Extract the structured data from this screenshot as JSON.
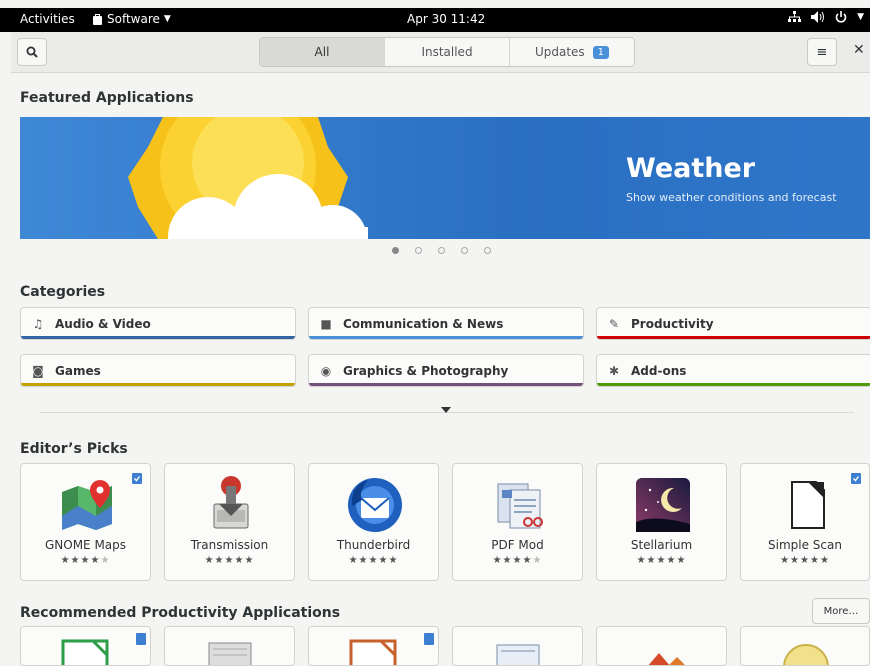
{
  "topbar": {
    "activities": "Activities",
    "app_menu": "Software",
    "clock": "Apr 30  11:42"
  },
  "header": {
    "tabs": [
      {
        "label": "All",
        "active": true
      },
      {
        "label": "Installed",
        "active": false
      },
      {
        "label": "Updates",
        "active": false,
        "badge": "1"
      }
    ]
  },
  "featured": {
    "heading": "Featured Applications",
    "banner_title": "Weather",
    "banner_subtitle": "Show weather conditions and forecast",
    "carousel_pages": 5,
    "carousel_active": 1
  },
  "categories": {
    "heading": "Categories",
    "items": [
      {
        "label": "Audio & Video",
        "icon": "music-note-icon",
        "color": "#3465a4"
      },
      {
        "label": "Communication & News",
        "icon": "chat-icon",
        "color": "#4a90d9"
      },
      {
        "label": "Productivity",
        "icon": "edit-icon",
        "color": "#cc0000"
      },
      {
        "label": "Games",
        "icon": "gamepad-icon",
        "color": "#c4a000"
      },
      {
        "label": "Graphics & Photography",
        "icon": "camera-icon",
        "color": "#75507b"
      },
      {
        "label": "Add-ons",
        "icon": "puzzle-icon",
        "color": "#4e9a06"
      }
    ]
  },
  "editors_picks": {
    "heading": "Editor’s Picks",
    "apps": [
      {
        "name": "GNOME Maps",
        "rating": 4,
        "installed": true,
        "icon": "maps-icon"
      },
      {
        "name": "Transmission",
        "rating": 5,
        "installed": false,
        "icon": "transmission-icon"
      },
      {
        "name": "Thunderbird",
        "rating": 5,
        "installed": false,
        "icon": "thunderbird-icon"
      },
      {
        "name": "PDF Mod",
        "rating": 4,
        "installed": false,
        "icon": "pdfmod-icon"
      },
      {
        "name": "Stellarium",
        "rating": 5,
        "installed": false,
        "icon": "stellarium-icon"
      },
      {
        "name": "Simple Scan",
        "rating": 5,
        "installed": true,
        "icon": "scanner-icon"
      }
    ]
  },
  "recommended": {
    "heading": "Recommended Productivity Applications",
    "more_label": "More…"
  },
  "colors": {
    "accent": "#4a90d9",
    "banner": "#2a6fc2"
  }
}
